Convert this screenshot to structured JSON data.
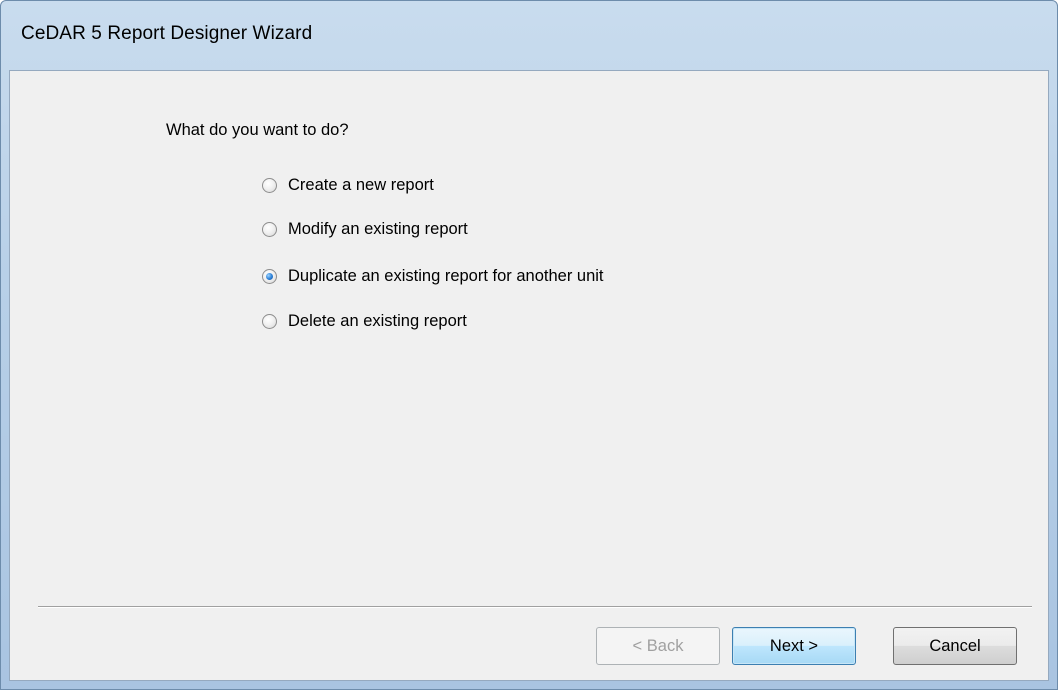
{
  "window": {
    "title": "CeDAR 5 Report Designer Wizard"
  },
  "wizard": {
    "question": "What do you want to do?",
    "options": [
      {
        "label": "Create a new report",
        "checked": false
      },
      {
        "label": "Modify an existing report",
        "checked": false
      },
      {
        "label": "Duplicate an existing report for another unit",
        "checked": true
      },
      {
        "label": "Delete an existing report",
        "checked": false
      }
    ]
  },
  "buttons": {
    "back": "< Back",
    "next": "Next >",
    "cancel": "Cancel"
  }
}
